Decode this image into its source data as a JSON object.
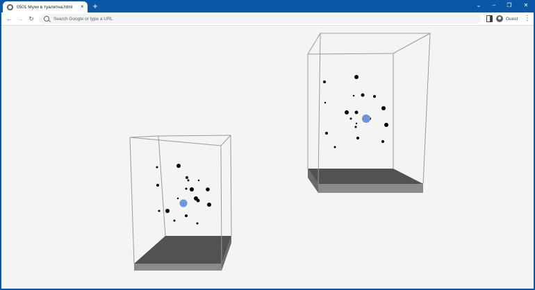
{
  "tab": {
    "title": "0501 Мухи в туалетна.html",
    "close_glyph": "×",
    "icon": "globe-icon"
  },
  "new_tab_glyph": "+",
  "window_controls": {
    "collapse": "⌄",
    "minimize": "–",
    "restore": "❐",
    "close": "✕"
  },
  "toolbar": {
    "back_glyph": "←",
    "forward_glyph": "→",
    "reload_glyph": "↻",
    "omnibox_placeholder": "Search Google or type a URL",
    "profile_label": "Guest",
    "menu_glyph": "⋮"
  },
  "colors": {
    "chrome_blue": "#0b57a8",
    "viewport_bg": "#f4f4f4",
    "fly": "#000000",
    "target": "#6a95e0",
    "floor_top": "#525252",
    "floor_side": "#8a8a8a",
    "box_edge": "#9a9a9a"
  }
}
